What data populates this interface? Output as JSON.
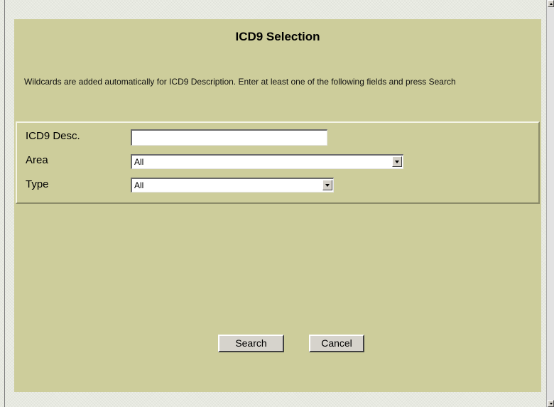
{
  "dialog": {
    "title": "ICD9 Selection",
    "instructions": "Wildcards are added automatically for ICD9 Description. Enter at least one of the following fields and press Search"
  },
  "form": {
    "icd9_desc": {
      "label": "ICD9 Desc.",
      "value": ""
    },
    "area": {
      "label": "Area",
      "selected": "All"
    },
    "type": {
      "label": "Type",
      "selected": "All"
    }
  },
  "buttons": {
    "search": "Search",
    "cancel": "Cancel"
  },
  "colors": {
    "panel_background": "#cdcd9b",
    "page_background": "#eceee6"
  }
}
